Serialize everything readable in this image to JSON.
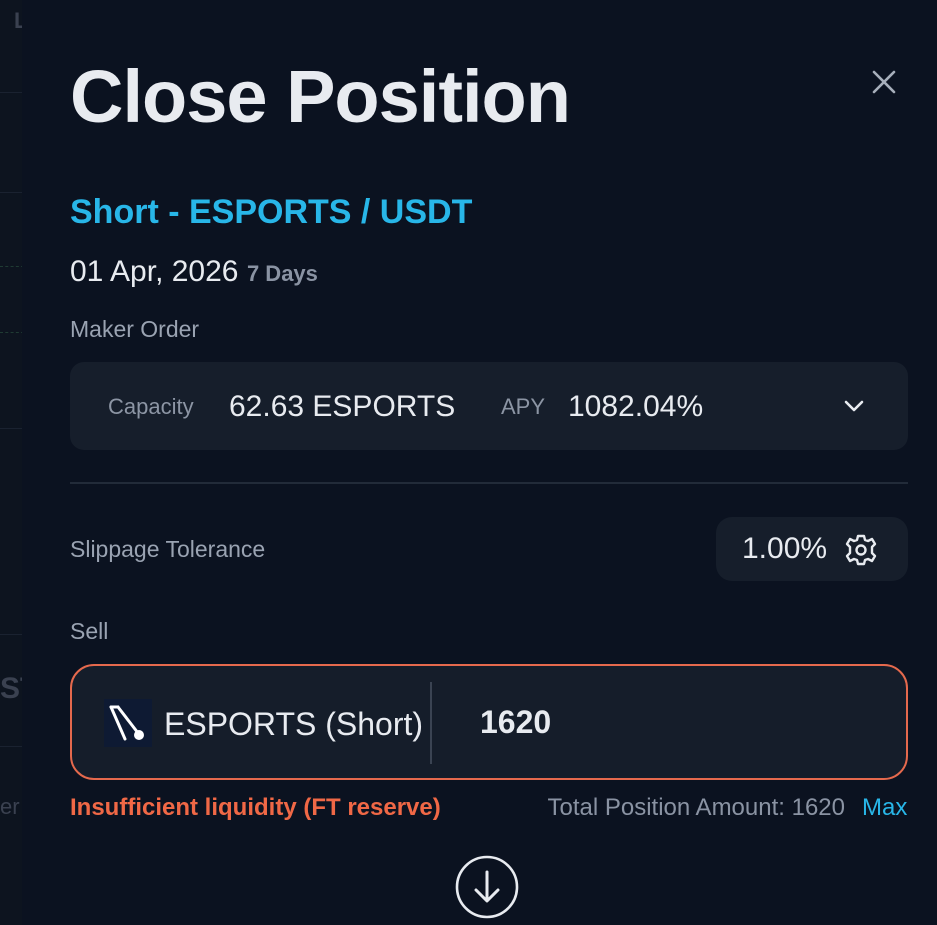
{
  "modal": {
    "title": "Close Position",
    "close_icon": "close-icon",
    "pair": "Short - ESPORTS / USDT",
    "date": "01 Apr, 2026",
    "days": "7 Days",
    "order_type_label": "Maker Order"
  },
  "order": {
    "capacity_label": "Capacity",
    "capacity_value": "62.63 ESPORTS",
    "apy_label": "APY",
    "apy_value": "1082.04%",
    "expand_icon": "chevron-down-icon"
  },
  "slippage": {
    "label": "Slippage Tolerance",
    "value": "1.00%",
    "icon": "gear-icon"
  },
  "sell": {
    "label": "Sell",
    "token_icon": "esports-token-icon",
    "token_name": "ESPORTS (Short)",
    "amount": "1620"
  },
  "footer": {
    "error": "Insufficient liquidity (FT reserve)",
    "total_position": "Total Position Amount: 1620",
    "max_label": "Max",
    "swap_icon": "arrow-down-circle-icon"
  },
  "backdrop": {
    "fragment_1": "L",
    "fragment_2": "ST",
    "fragment_3": "er"
  },
  "colors": {
    "background": "#0b1220",
    "accent": "#28b6e8",
    "error": "#f06846",
    "border_error": "#e5694d",
    "card": "#161e2b"
  }
}
